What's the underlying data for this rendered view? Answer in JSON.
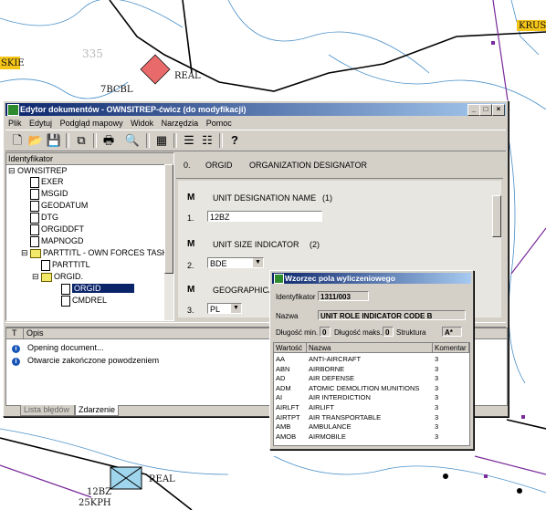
{
  "map": {
    "labels": {
      "skie": "SKIE",
      "krusz": "KRUSZ",
      "real_top": "REAL",
      "unit_top": "7BCBL",
      "real_bottom": "REAL",
      "unit_bottom_1": "12BZ",
      "unit_bottom_2": "25KPH",
      "contour": "335"
    }
  },
  "window": {
    "title": "Edytor dokumentów - OWNSITREP-ćwicz (do modyfikacji)",
    "controls": {
      "minimize": "_",
      "maximize": "□",
      "close": "×"
    }
  },
  "menu": [
    "Plik",
    "Edytuj",
    "Podgląd mapowy",
    "Widok",
    "Narzędzia",
    "Pomoc"
  ],
  "toolbar": {
    "icons": [
      "new-document-icon",
      "open-folder-icon",
      "save-icon",
      "copy-icon",
      "print-icon",
      "find-icon",
      "map-preview-icon",
      "list-view-icon",
      "detail-view-icon",
      "help-icon"
    ],
    "help_glyph": "?"
  },
  "tree": {
    "header": "Identyfikator",
    "root": "OWNSITREP",
    "items": [
      {
        "label": "EXER",
        "kind": "doc",
        "level": 1
      },
      {
        "label": "MSGID",
        "kind": "doc",
        "level": 1
      },
      {
        "label": "GEODATUM",
        "kind": "doc",
        "level": 1
      },
      {
        "label": "DTG",
        "kind": "doc",
        "level": 1
      },
      {
        "label": "ORGIDDFT",
        "kind": "doc",
        "level": 1
      },
      {
        "label": "MAPNOGD",
        "kind": "doc",
        "level": 1
      },
      {
        "label": "PARTTITL - OWN FORCES TASK",
        "kind": "folder",
        "level": 1
      },
      {
        "label": "PARTTITL",
        "kind": "doc",
        "level": 2
      },
      {
        "label": "ORGID.",
        "kind": "folder",
        "level": 2
      },
      {
        "label": "ORGID",
        "kind": "doc",
        "level": 3,
        "selected": true
      },
      {
        "label": "CMDREL",
        "kind": "doc",
        "level": 3
      }
    ]
  },
  "detail": {
    "header_num": "0.",
    "header_code": "ORGID",
    "header_name": "ORGANIZATION DESIGNATOR",
    "fields": [
      {
        "m": "M",
        "name": "UNIT DESIGNATION NAME",
        "ref": "(1)",
        "num": "1.",
        "value": "12BZ"
      },
      {
        "m": "M",
        "name": "UNIT SIZE INDICATOR",
        "ref": "(2)",
        "num": "2.",
        "value": "BDE"
      },
      {
        "m": "M",
        "name": "GEOGRAPHICAL",
        "ref": "",
        "num": "3.",
        "value": "PL"
      }
    ]
  },
  "log": {
    "col_t": "T",
    "col_desc": "Opis",
    "rows": [
      "Opening document...",
      "Otwarcie zakończone powodzeniem"
    ],
    "tabs": [
      "Lista błędów",
      "Zdarzenie"
    ]
  },
  "dialog": {
    "title": "Wzorzec pola wyliczeniowego",
    "id_label": "Identyfikator",
    "id_value": "1311/003",
    "name_label": "Nazwa",
    "name_value": "UNIT ROLE INDICATOR CODE B",
    "min_label": "Długość min.",
    "min_value": "0",
    "max_label": "Długość maks.",
    "max_value": "0",
    "struct_label": "Struktura",
    "struct_value": "A*",
    "columns": [
      "Wartość",
      "Nazwa",
      "Komentar"
    ],
    "rows": [
      {
        "code": "AA",
        "name": "ANTI-AIRCRAFT",
        "c": "3"
      },
      {
        "code": "ABN",
        "name": "AIRBORNE",
        "c": "3"
      },
      {
        "code": "AD",
        "name": "AIR DEFENSE",
        "c": "3"
      },
      {
        "code": "ADM",
        "name": "ATOMIC DEMOLITION MUNITIONS",
        "c": "3"
      },
      {
        "code": "AI",
        "name": "AIR INTERDICTION",
        "c": "3"
      },
      {
        "code": "AIRLFT",
        "name": "AIRLIFT",
        "c": "3"
      },
      {
        "code": "AIRTPT",
        "name": "AIR TRANSPORTABLE",
        "c": "3"
      },
      {
        "code": "AMB",
        "name": "AMBULANCE",
        "c": "3"
      },
      {
        "code": "AMOB",
        "name": "AIRMOBILE",
        "c": "3"
      }
    ]
  }
}
